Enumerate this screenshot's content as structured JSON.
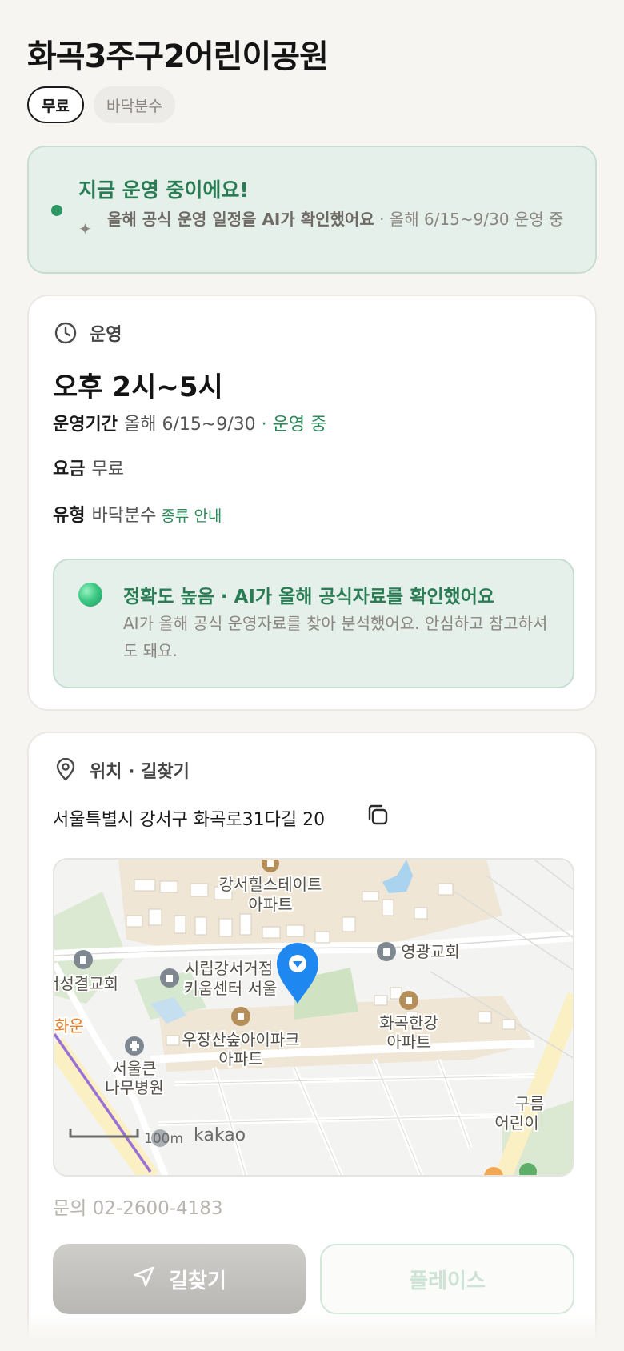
{
  "place": {
    "title": "화곡3주구2어린이공원",
    "tags": [
      "무료",
      "바닥분수"
    ]
  },
  "status": {
    "title": "지금 운영 중이에요!",
    "ai_note": "올해 공식 운영 일정을 AI가 확인했어요",
    "period_note": " · 올해 6/15~9/30 운영 중"
  },
  "operation": {
    "section_label": "운영",
    "hours": "오후 2시~5시",
    "period_key": "운영기간",
    "period_value": "올해 6/15~9/30",
    "period_status": " · 운영 중",
    "fee_key": "요금",
    "fee_value": "무료",
    "type_key": "유형",
    "type_value": "바닥분수",
    "type_link": "종류 안내",
    "accuracy_title": "정확도 높음 · AI가 올해 공식자료를 확인했어요",
    "accuracy_body": "AI가 올해 공식 운영자료를 찾아 분석했어요. 안심하고 참고하셔도 돼요."
  },
  "location": {
    "section_label": "위치 · 길찾기",
    "address": "서울특별시 강서구 화곡로31다길 20",
    "map_labels": {
      "apt1_a": "강서힐스테이트",
      "apt1_b": "아파트",
      "church1": "영광교회",
      "church2": "서성결교회",
      "lib_a": "시립강서거점",
      "lib_b": "키움센터 서울",
      "apt2_a": "우장산숲아이파크",
      "apt2_b": "아파트",
      "apt3_a": "화곡한강",
      "apt3_b": "아파트",
      "hosp_a": "서울큰",
      "hosp_b": "나무병원",
      "station": "화운",
      "park_a": "구름",
      "park_b": "어린이",
      "scale": "100m",
      "brand": "kakao"
    },
    "contact": "문의 02-2600-4183",
    "directions_label": "길찾기",
    "place_label": "플레이스"
  },
  "colors": {
    "accent_green": "#2a8a5a",
    "status_bg": "#e6f0eb",
    "marker_blue": "#1e88f0"
  }
}
